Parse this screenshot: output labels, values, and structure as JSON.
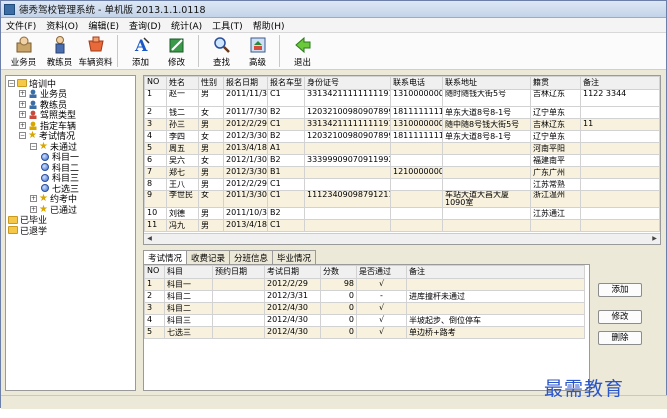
{
  "window": {
    "title": "德秀驾校管理系统 - 单机版 2013.1.1.0118"
  },
  "menu": [
    "文件(F)",
    "资料(O)",
    "编辑(E)",
    "查询(D)",
    "统计(A)",
    "工具(T)",
    "帮助(H)"
  ],
  "toolbar": [
    {
      "label": "业务员",
      "icon": "salesman-icon"
    },
    {
      "label": "教练员",
      "icon": "coach-icon"
    },
    {
      "label": "车辆资料",
      "icon": "vehicle-icon"
    },
    {
      "label": "添加",
      "icon": "add-icon"
    },
    {
      "label": "修改",
      "icon": "edit-icon"
    },
    {
      "label": "查找",
      "icon": "find-icon"
    },
    {
      "label": "高级",
      "icon": "advanced-icon"
    },
    {
      "label": "退出",
      "icon": "exit-icon"
    }
  ],
  "tree": [
    {
      "label": "培训中",
      "level": 0,
      "icon": "folder",
      "exp": "−"
    },
    {
      "label": "业务员",
      "level": 1,
      "icon": "people",
      "exp": "+"
    },
    {
      "label": "教练员",
      "level": 1,
      "icon": "people",
      "exp": "+"
    },
    {
      "label": "驾照类型",
      "level": 1,
      "icon": "license",
      "exp": "+"
    },
    {
      "label": "指定车辆",
      "level": 1,
      "icon": "car",
      "exp": "+"
    },
    {
      "label": "考试情况",
      "level": 1,
      "icon": "star",
      "exp": "−"
    },
    {
      "label": "未通过",
      "level": 2,
      "icon": "star",
      "exp": "−"
    },
    {
      "label": "科目一",
      "level": 3,
      "icon": "ball",
      "exp": ""
    },
    {
      "label": "科目二",
      "level": 3,
      "icon": "ball",
      "exp": ""
    },
    {
      "label": "科目三",
      "level": 3,
      "icon": "ball",
      "exp": ""
    },
    {
      "label": "七选三",
      "level": 3,
      "icon": "ball",
      "exp": ""
    },
    {
      "label": "约考中",
      "level": 2,
      "icon": "star",
      "exp": "+"
    },
    {
      "label": "已通过",
      "level": 2,
      "icon": "star",
      "exp": "+"
    },
    {
      "label": "已毕业",
      "level": 0,
      "icon": "folder",
      "exp": ""
    },
    {
      "label": "已退学",
      "level": 0,
      "icon": "folder",
      "exp": ""
    }
  ],
  "students": {
    "columns": [
      "NO",
      "姓名",
      "性别",
      "报名日期",
      "报名车型",
      "身份证号",
      "联系电话",
      "联系地址",
      "籍贯",
      "备注"
    ],
    "rows": [
      [
        "1",
        "赵一",
        "男",
        "2011/11/30",
        "C1",
        "331342111111111911",
        "13100000000",
        "随时随钱大街5号",
        "吉林辽东",
        "1122 3344"
      ],
      [
        "2",
        "钱二",
        "女",
        "2011/7/30",
        "B2",
        "120321009809078991X",
        "18111111111",
        "单东大道8号8-1号",
        "辽宁单东",
        ""
      ],
      [
        "3",
        "孙三",
        "男",
        "2012/2/29",
        "C1",
        "331342111111111911",
        "13100000000",
        "随中随8号钱大街5号",
        "吉林辽东",
        "11"
      ],
      [
        "4",
        "李四",
        "女",
        "2012/3/30",
        "B2",
        "120321009809078991X",
        "18111111111",
        "单东大道8号8-1号",
        "辽宁单东",
        ""
      ],
      [
        "5",
        "周五",
        "男",
        "2013/4/18",
        "A1",
        "",
        "",
        "",
        "河南平阳",
        ""
      ],
      [
        "6",
        "吴六",
        "女",
        "2012/1/30",
        "B2",
        "333999090709119921",
        "",
        "",
        "福建南平",
        ""
      ],
      [
        "7",
        "郑七",
        "男",
        "2012/3/30",
        "B1",
        "",
        "12100000000",
        "",
        "广东广州",
        ""
      ],
      [
        "8",
        "王八",
        "男",
        "2012/2/29",
        "C1",
        "",
        "",
        "",
        "江苏常熟",
        ""
      ],
      [
        "9",
        "李世民",
        "女",
        "2011/3/30",
        "C1",
        "111234090987912119",
        "",
        "车站大道大昌大厦1090室",
        "浙江温州",
        ""
      ],
      [
        "10",
        "刘德",
        "男",
        "2011/10/30",
        "B2",
        "",
        "",
        "",
        "江苏通江",
        ""
      ],
      [
        "11",
        "冯九",
        "男",
        "2013/4/18",
        "C1",
        "",
        "",
        "",
        "",
        ""
      ]
    ]
  },
  "tabs": [
    "考试情况",
    "收费记录",
    "分班信息",
    "毕业情况"
  ],
  "exams": {
    "columns": [
      "NO",
      "科目",
      "预约日期",
      "考试日期",
      "分数",
      "是否通过",
      "备注"
    ],
    "rows": [
      [
        "1",
        "科目一",
        "",
        "2012/2/29",
        "98",
        "√",
        ""
      ],
      [
        "2",
        "科目二",
        "",
        "2012/3/31",
        "0",
        "-",
        "进库撞杆未通过"
      ],
      [
        "3",
        "科目二",
        "",
        "2012/4/30",
        "0",
        "√",
        ""
      ],
      [
        "4",
        "科目三",
        "",
        "2012/4/30",
        "0",
        "√",
        "半坡起步、倒位停车"
      ],
      [
        "5",
        "七选三",
        "",
        "2012/4/30",
        "0",
        "√",
        "单边桥+路考"
      ]
    ]
  },
  "buttons": {
    "add": "添加",
    "modify": "修改",
    "delete": "删除"
  },
  "watermark": "最需教育"
}
